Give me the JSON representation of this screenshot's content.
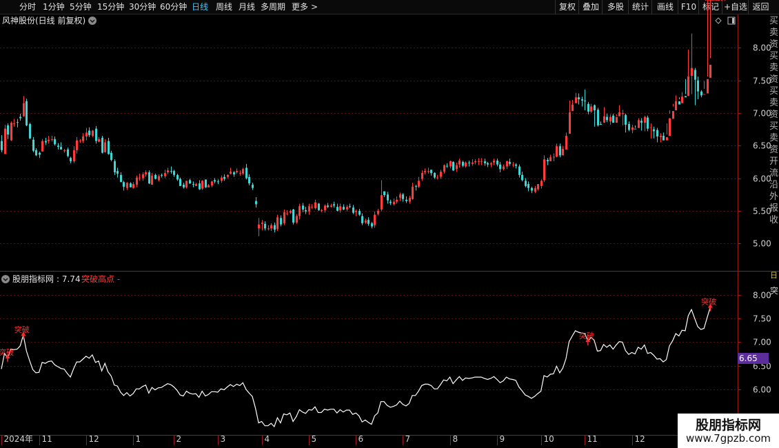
{
  "toolbar": {
    "periods": [
      "分时",
      "1分钟",
      "5分钟",
      "15分钟",
      "30分钟",
      "60分钟",
      "日线",
      "周线",
      "月线",
      "多周期",
      "更多"
    ],
    "active_period": "日线",
    "more_chevron": ">",
    "right_buttons": [
      "复权",
      "叠加",
      "多股",
      "统计",
      "画线",
      "F10",
      "标记",
      "+自选",
      "返回"
    ]
  },
  "main_pane": {
    "title": "风神股份(日线 前复权)",
    "dropdown_icon": "chevron-down-icon",
    "diamond_icon": "diamond-icon",
    "window_icon": "window-icon"
  },
  "indicator_pane": {
    "title": "股朋指标网",
    "value_text": ": 7.74",
    "signal_label": "突破高点 -",
    "current_badge": "6.65",
    "break_label": "突破",
    "side_label": "突"
  },
  "right_strip": {
    "text": "买卖资买卖资买卖资买卖资 开流 沿 外 报 收",
    "top_label": "日"
  },
  "watermark": {
    "line1": "股朋指标网",
    "line2": "www.7gpzb.com"
  },
  "colors": {
    "up": "#ff3b3b",
    "down": "#3fd6d6",
    "line": "#ffffff",
    "axis": "#9c1a1a",
    "grid": "#5a1010",
    "active": "#37c6ff",
    "badge": "#5b2e9c"
  },
  "chart_data": [
    {
      "type": "candlestick",
      "ylim": [
        4.6,
        8.5
      ],
      "y_ticks": [
        "8.00",
        "7.50",
        "7.00",
        "6.50",
        "6.00",
        "5.50",
        "5.00"
      ],
      "y_tick_values": [
        8.0,
        7.5,
        7.0,
        6.5,
        6.0,
        5.5,
        5.0
      ],
      "x_labels": [
        "2024年",
        "11",
        "12",
        "1",
        "2",
        "3",
        "4",
        "5",
        "6",
        "7",
        "8",
        "9",
        "10",
        "11",
        "12",
        "1"
      ],
      "x_label_index": [
        0,
        12,
        27,
        42,
        55,
        69,
        83,
        98,
        113,
        128,
        143,
        158,
        172,
        186,
        201,
        216
      ],
      "close": [
        6.43,
        6.76,
        6.67,
        6.85,
        6.84,
        6.85,
        6.92,
        7.15,
        6.81,
        6.61,
        6.42,
        6.35,
        6.36,
        6.57,
        6.55,
        6.59,
        6.6,
        6.52,
        6.48,
        6.44,
        6.43,
        6.34,
        6.26,
        6.43,
        6.58,
        6.58,
        6.64,
        6.7,
        6.66,
        6.73,
        6.57,
        6.6,
        6.39,
        6.55,
        6.37,
        6.28,
        6.09,
        6.07,
        5.94,
        5.87,
        5.93,
        5.86,
        5.91,
        6.01,
        6.01,
        6.06,
        6.09,
        5.92,
        6.04,
        5.99,
        6.03,
        6.04,
        6.08,
        6.12,
        6.1,
        6.05,
        5.98,
        5.88,
        5.86,
        5.96,
        5.92,
        5.9,
        5.91,
        5.83,
        5.96,
        5.86,
        5.89,
        5.95,
        5.95,
        5.94,
        6.01,
        5.99,
        6.05,
        6.1,
        6.06,
        6.11,
        6.08,
        6.14,
        6.0,
        5.92,
        5.85,
        5.6,
        5.29,
        5.32,
        5.23,
        5.23,
        5.28,
        5.21,
        5.4,
        5.29,
        5.48,
        5.46,
        5.5,
        5.32,
        5.42,
        5.57,
        5.52,
        5.49,
        5.57,
        5.56,
        5.63,
        5.51,
        5.51,
        5.58,
        5.56,
        5.58,
        5.58,
        5.5,
        5.57,
        5.52,
        5.56,
        5.56,
        5.47,
        5.5,
        5.44,
        5.31,
        5.35,
        5.3,
        5.26,
        5.44,
        5.5,
        5.74,
        5.74,
        5.66,
        5.62,
        5.64,
        5.67,
        5.75,
        5.68,
        5.65,
        5.7,
        5.87,
        5.87,
        5.96,
        6.08,
        6.11,
        6.11,
        6.08,
        6.01,
        6.01,
        6.1,
        6.2,
        6.18,
        6.26,
        6.12,
        6.2,
        6.27,
        6.19,
        6.24,
        6.23,
        6.24,
        6.26,
        6.26,
        6.26,
        6.23,
        6.21,
        6.23,
        6.27,
        6.21,
        6.14,
        6.18,
        6.26,
        6.22,
        6.21,
        6.19,
        6.05,
        5.97,
        5.88,
        5.85,
        5.81,
        5.85,
        5.91,
        5.96,
        6.29,
        6.26,
        6.32,
        6.33,
        6.49,
        6.35,
        6.45,
        6.65,
        7.01,
        7.13,
        7.24,
        7.21,
        7.19,
        7.18,
        7.02,
        7.1,
        7.04,
        6.81,
        6.82,
        6.95,
        6.89,
        6.94,
        6.85,
        6.94,
        7.01,
        7.0,
        6.82,
        6.74,
        6.78,
        6.75,
        6.89,
        6.85,
        6.94,
        6.76,
        6.78,
        6.72,
        6.64,
        6.65,
        6.58,
        6.63,
        6.92,
        7.03,
        7.18,
        7.13,
        7.25,
        7.24,
        7.56,
        7.69,
        7.51,
        7.33,
        7.27,
        7.29,
        7.52,
        7.74
      ],
      "open": [
        6.57,
        6.37,
        6.81,
        6.58,
        6.83,
        6.86,
        6.94,
        6.95,
        7.18,
        6.83,
        6.59,
        6.43,
        6.39,
        6.41,
        6.57,
        6.57,
        6.6,
        6.6,
        6.5,
        6.48,
        6.43,
        6.44,
        6.31,
        6.26,
        6.43,
        6.58,
        6.57,
        6.64,
        6.73,
        6.65,
        6.76,
        6.56,
        6.62,
        6.4,
        6.57,
        6.39,
        6.26,
        6.11,
        6.05,
        5.94,
        5.85,
        5.92,
        5.85,
        5.9,
        6.01,
        6.0,
        6.06,
        6.09,
        5.9,
        6.05,
        5.97,
        6.05,
        6.03,
        6.09,
        6.11,
        6.11,
        6.05,
        5.99,
        5.9,
        5.86,
        5.97,
        5.91,
        5.88,
        5.92,
        5.84,
        5.98,
        5.86,
        5.89,
        5.97,
        5.95,
        5.96,
        6.02,
        6.02,
        6.07,
        6.09,
        6.09,
        6.08,
        6.07,
        6.16,
        6.02,
        5.9,
        5.65,
        5.23,
        5.3,
        5.3,
        5.22,
        5.23,
        5.28,
        5.22,
        5.39,
        5.31,
        5.46,
        5.47,
        5.52,
        5.32,
        5.42,
        5.58,
        5.51,
        5.49,
        5.55,
        5.54,
        5.61,
        5.51,
        5.51,
        5.58,
        5.56,
        5.6,
        5.56,
        5.51,
        5.56,
        5.52,
        5.57,
        5.55,
        5.48,
        5.5,
        5.42,
        5.32,
        5.36,
        5.31,
        5.28,
        5.45,
        5.52,
        5.8,
        5.75,
        5.64,
        5.6,
        5.64,
        5.7,
        5.75,
        5.67,
        5.64,
        5.68,
        5.88,
        5.87,
        5.99,
        6.09,
        6.11,
        6.13,
        6.08,
        6.01,
        6.02,
        6.1,
        6.19,
        6.18,
        6.25,
        6.14,
        6.21,
        6.25,
        6.18,
        6.24,
        6.22,
        6.25,
        6.26,
        6.25,
        6.26,
        6.23,
        6.21,
        6.24,
        6.27,
        6.21,
        6.14,
        6.18,
        6.25,
        6.21,
        6.21,
        6.18,
        6.05,
        5.96,
        5.91,
        5.85,
        5.79,
        5.83,
        5.88,
        5.97,
        6.28,
        6.26,
        6.33,
        6.33,
        6.49,
        6.35,
        6.44,
        6.68,
        7.03,
        7.15,
        7.24,
        7.21,
        7.19,
        7.14,
        7.02,
        7.12,
        7.05,
        6.83,
        6.85,
        6.94,
        6.87,
        6.96,
        6.85,
        6.95,
        7.0,
        6.97,
        6.83,
        6.74,
        6.76,
        6.77,
        6.88,
        6.85,
        6.93,
        6.78,
        6.75,
        6.74,
        6.63,
        6.65,
        6.58,
        6.65,
        6.91,
        7.04,
        7.18,
        7.15,
        7.26,
        7.26,
        7.57,
        7.66,
        7.5,
        7.33,
        7.28,
        7.3,
        7.54
      ],
      "high": [
        6.66,
        6.82,
        6.84,
        6.87,
        6.91,
        6.91,
        6.99,
        7.26,
        7.22,
        6.85,
        6.63,
        6.46,
        6.41,
        6.6,
        6.62,
        6.65,
        6.65,
        6.64,
        6.54,
        6.55,
        6.45,
        6.47,
        6.33,
        6.49,
        6.63,
        6.6,
        6.69,
        6.77,
        6.78,
        6.74,
        6.8,
        6.63,
        6.65,
        6.6,
        6.62,
        6.42,
        6.29,
        6.16,
        6.09,
        5.96,
        5.94,
        5.94,
        5.94,
        6.04,
        6.07,
        6.09,
        6.12,
        6.12,
        6.08,
        6.07,
        6.06,
        6.07,
        6.13,
        6.16,
        6.18,
        6.13,
        6.07,
        6.01,
        5.93,
        5.96,
        5.99,
        5.95,
        5.93,
        5.97,
        5.97,
        5.98,
        5.91,
        5.96,
        6.0,
        5.98,
        6.04,
        6.06,
        6.06,
        6.16,
        6.11,
        6.15,
        6.12,
        6.16,
        6.22,
        6.06,
        5.93,
        5.71,
        5.39,
        5.36,
        5.34,
        5.28,
        5.31,
        5.32,
        5.44,
        5.43,
        5.52,
        5.51,
        5.52,
        5.53,
        5.45,
        5.61,
        5.62,
        5.56,
        5.61,
        5.6,
        5.67,
        5.62,
        5.53,
        5.6,
        5.62,
        5.61,
        5.64,
        5.61,
        5.61,
        5.6,
        5.59,
        5.61,
        5.59,
        5.52,
        5.53,
        5.46,
        5.38,
        5.4,
        5.33,
        5.49,
        5.53,
        5.97,
        5.79,
        5.79,
        5.67,
        5.69,
        5.72,
        5.78,
        5.77,
        5.72,
        5.73,
        5.93,
        5.9,
        6.02,
        6.12,
        6.15,
        6.16,
        6.12,
        6.09,
        6.05,
        6.13,
        6.21,
        6.23,
        6.27,
        6.26,
        6.24,
        6.3,
        6.27,
        6.26,
        6.27,
        6.29,
        6.29,
        6.31,
        6.31,
        6.3,
        6.25,
        6.25,
        6.3,
        6.3,
        6.25,
        6.21,
        6.27,
        6.3,
        6.25,
        6.23,
        6.21,
        6.1,
        6.0,
        5.95,
        5.87,
        5.88,
        5.91,
        5.98,
        6.35,
        6.31,
        6.36,
        6.38,
        6.53,
        6.53,
        6.49,
        6.7,
        7.19,
        7.2,
        7.31,
        7.3,
        7.25,
        7.36,
        7.17,
        7.14,
        7.13,
        7.08,
        6.87,
        7.09,
        6.99,
        6.98,
        6.99,
        6.98,
        7.12,
        7.05,
        6.99,
        6.87,
        6.82,
        6.81,
        6.92,
        6.92,
        6.96,
        6.96,
        6.84,
        6.79,
        6.77,
        6.69,
        6.7,
        6.67,
        7.04,
        7.14,
        7.27,
        7.24,
        7.32,
        7.29,
        7.97,
        8.22,
        7.69,
        7.56,
        7.35,
        7.37,
        7.56,
        7.84
      ],
      "low": [
        6.4,
        6.37,
        6.6,
        6.57,
        6.79,
        6.78,
        6.88,
        6.94,
        6.8,
        6.6,
        6.4,
        6.34,
        6.31,
        6.41,
        6.51,
        6.53,
        6.56,
        6.5,
        6.44,
        6.44,
        6.39,
        6.32,
        6.23,
        6.23,
        6.38,
        6.54,
        6.54,
        6.58,
        6.63,
        6.63,
        6.53,
        6.55,
        6.38,
        6.39,
        6.36,
        6.26,
        6.05,
        6.01,
        5.94,
        5.81,
        5.82,
        5.86,
        5.84,
        5.86,
        5.96,
        5.96,
        6.02,
        5.91,
        5.9,
        5.98,
        5.95,
        6.01,
        6.0,
        6.06,
        6.07,
        6.02,
        5.96,
        5.88,
        5.84,
        5.84,
        5.91,
        5.86,
        5.88,
        5.82,
        5.82,
        5.85,
        5.86,
        5.86,
        5.92,
        5.91,
        5.93,
        5.96,
        6.0,
        6.06,
        6.02,
        6.07,
        6.04,
        6.05,
        5.98,
        5.89,
        5.82,
        5.55,
        5.11,
        5.2,
        5.2,
        5.2,
        5.19,
        5.17,
        5.19,
        5.26,
        5.28,
        5.43,
        5.45,
        5.29,
        5.3,
        5.37,
        5.48,
        5.45,
        5.44,
        5.53,
        5.52,
        5.5,
        5.48,
        5.47,
        5.54,
        5.55,
        5.55,
        5.49,
        5.47,
        5.51,
        5.49,
        5.54,
        5.45,
        5.42,
        5.42,
        5.28,
        5.3,
        5.27,
        5.23,
        5.24,
        5.43,
        5.49,
        5.71,
        5.61,
        5.59,
        5.58,
        5.61,
        5.65,
        5.64,
        5.62,
        5.61,
        5.67,
        5.81,
        5.85,
        5.96,
        6.06,
        6.07,
        6.04,
        5.99,
        5.98,
        5.99,
        6.07,
        6.16,
        6.15,
        6.11,
        6.1,
        6.16,
        6.17,
        6.16,
        6.18,
        6.19,
        6.21,
        6.2,
        6.2,
        6.19,
        6.17,
        6.17,
        6.2,
        6.18,
        6.09,
        6.12,
        6.14,
        6.19,
        6.17,
        6.15,
        6.01,
        5.95,
        5.86,
        5.8,
        5.77,
        5.77,
        5.81,
        5.84,
        5.94,
        6.2,
        6.27,
        6.26,
        6.32,
        6.32,
        6.4,
        6.61,
        6.97,
        7.07,
        7.17,
        7.13,
        7.1,
        7.04,
        6.98,
        7.0,
        6.79,
        6.79,
        6.83,
        6.85,
        6.86,
        6.82,
        6.85,
        6.95,
        6.96,
        6.81,
        6.7,
        6.72,
        6.69,
        6.77,
        6.81,
        6.73,
        6.72,
        6.72,
        6.61,
        6.61,
        6.55,
        6.55,
        6.58,
        6.84,
        6.99,
        7.1,
        7.1,
        7.21,
        7.23,
        7.52,
        7.46,
        7.29,
        7.12,
        7.21,
        7.24,
        7.49
      ]
    },
    {
      "type": "line",
      "ylim": [
        5.05,
        8.45
      ],
      "y_ticks": [
        "8.00",
        "7.50",
        "7.00",
        "6.50",
        "6.00"
      ],
      "y_tick_values": [
        8.0,
        7.5,
        7.0,
        6.5,
        6.0
      ],
      "values_source": "close",
      "break_points": [
        2,
        7,
        187,
        226,
        227,
        228,
        229
      ]
    }
  ]
}
